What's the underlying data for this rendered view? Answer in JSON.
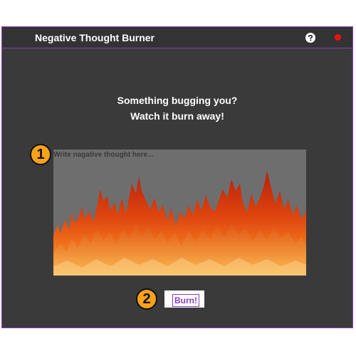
{
  "app": {
    "title": "Negative Thought Burner",
    "help_icon": "question-mark-icon",
    "close_icon": "close-dot-icon",
    "accent_color": "#8a3dc2"
  },
  "main": {
    "heading_line1": "Something bugging you?",
    "heading_line2": "Watch it burn away!",
    "thought_input": {
      "placeholder": "Write nagative thought here...",
      "value": ""
    },
    "burn_button_label": "Burn!"
  },
  "callouts": {
    "one": "1",
    "two": "2"
  }
}
